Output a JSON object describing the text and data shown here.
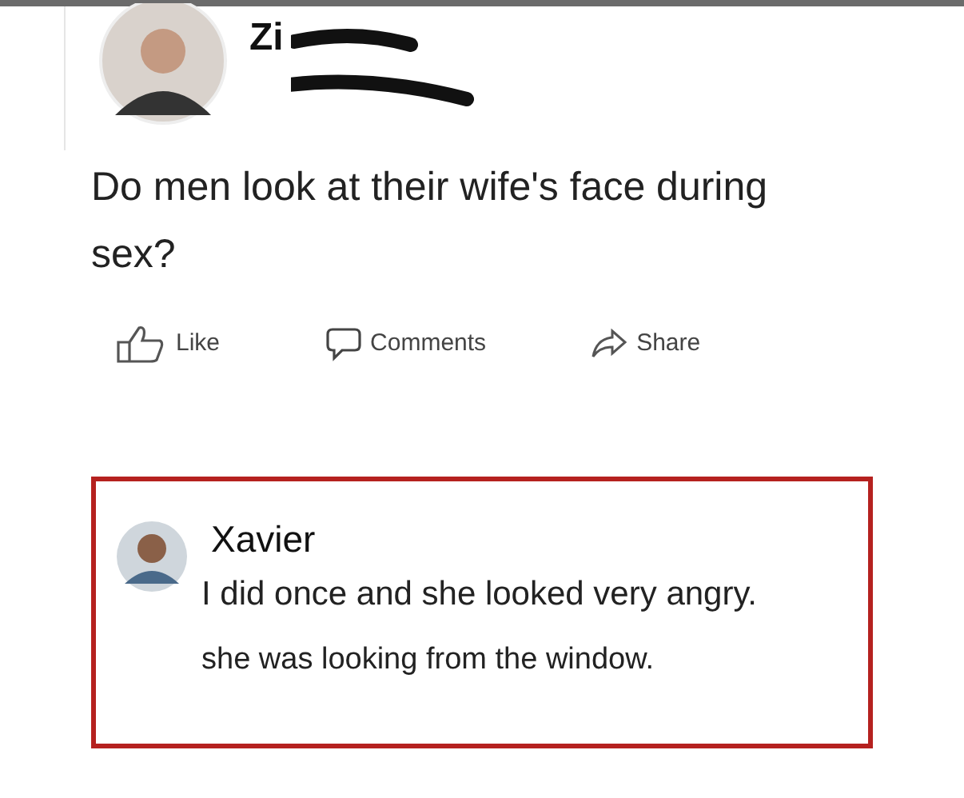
{
  "post": {
    "author": "Zi",
    "question": "Do men look at their wife's face during sex?",
    "actions": [
      {
        "kind": "like",
        "label": "Like"
      },
      {
        "kind": "comment",
        "label": "Comments"
      },
      {
        "kind": "share",
        "label": "Share"
      }
    ]
  },
  "reply": {
    "author": "Xavier",
    "lines": [
      "I did once and she looked very angry.",
      "she was looking from the window."
    ]
  }
}
